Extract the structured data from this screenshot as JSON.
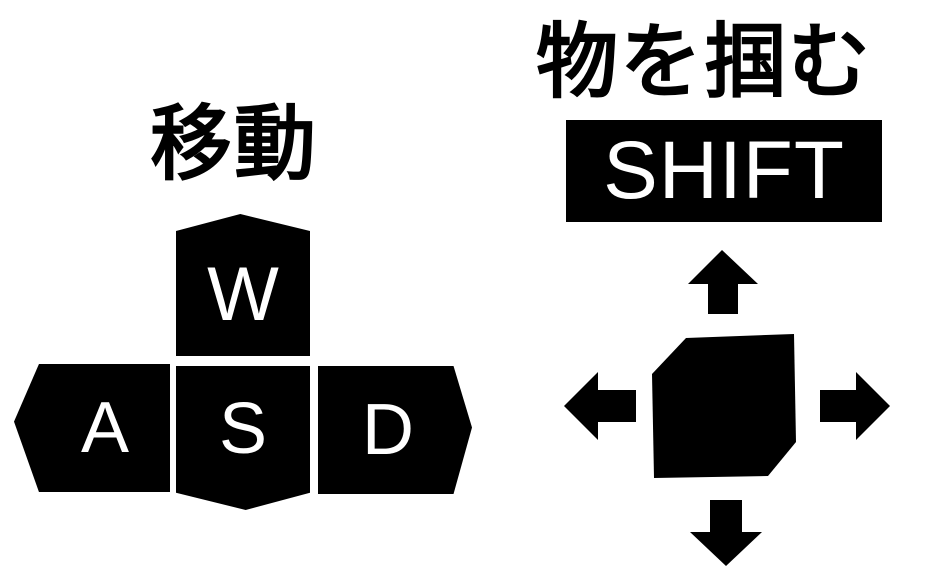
{
  "move_section": {
    "title": "移動",
    "keys": {
      "w": "W",
      "a": "A",
      "s": "S",
      "d": "D"
    }
  },
  "grab_section": {
    "title": "物を掴む",
    "key": "SHIFT"
  },
  "colors": {
    "background": "#ffffff",
    "key_fill": "#000000",
    "key_text": "#ffffff",
    "title_text": "#000000"
  },
  "icons": [
    "cube-icon",
    "arrow-up-icon",
    "arrow-down-icon",
    "arrow-left-icon",
    "arrow-right-icon"
  ]
}
